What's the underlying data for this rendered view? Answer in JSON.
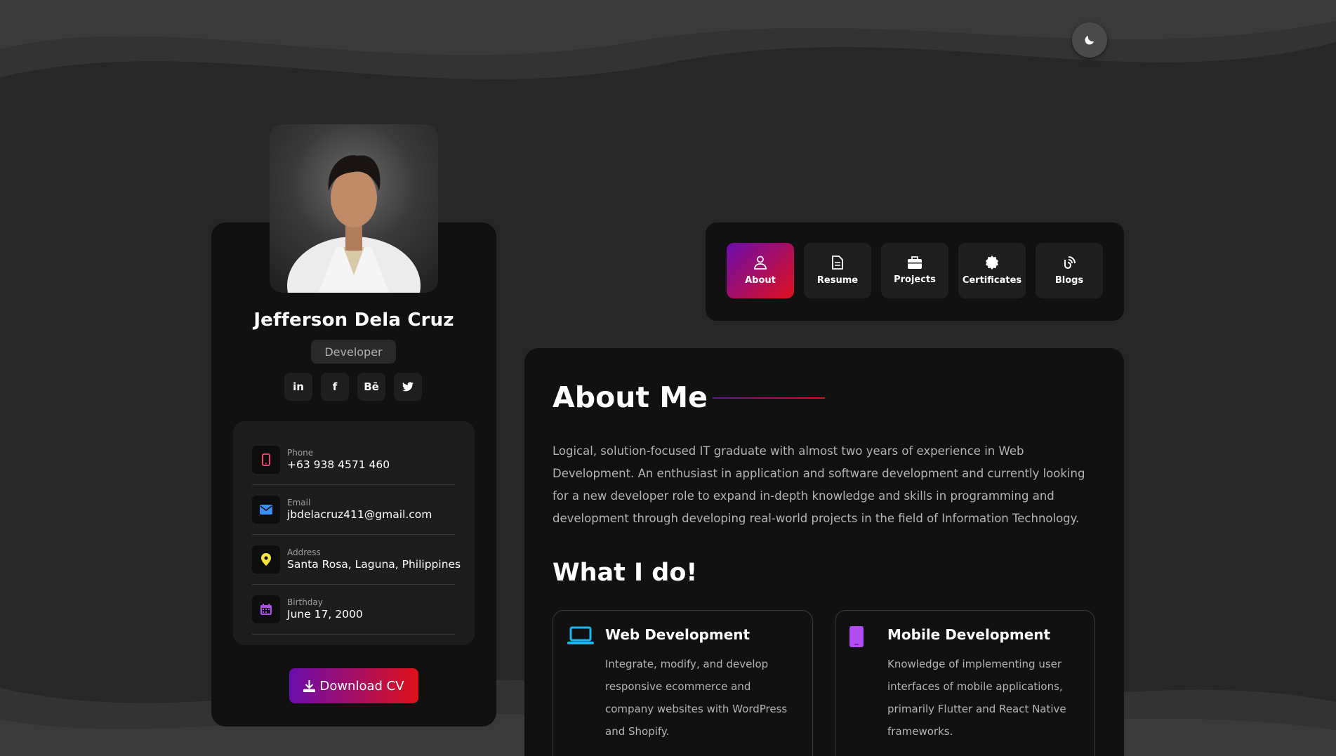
{
  "profile": {
    "name": "Jefferson Dela Cruz",
    "role": "Developer",
    "socials": [
      {
        "label": "in",
        "icon": "linkedin-icon"
      },
      {
        "label": "f",
        "icon": "facebook-icon"
      },
      {
        "label": "Bē",
        "icon": "behance-icon"
      },
      {
        "label": "",
        "icon": "twitter-icon"
      }
    ],
    "contacts": [
      {
        "label": "Phone",
        "value": "+63 938 4571 460",
        "icon": "phone-icon",
        "color": "#ff3a6e"
      },
      {
        "label": "Email",
        "value": "jbdelacruz411@gmail.com",
        "icon": "envelope-icon",
        "color": "#3b8ff6"
      },
      {
        "label": "Address",
        "value": "Santa Rosa, Laguna, Philippines",
        "icon": "map-pin-icon",
        "color": "#f5e23a"
      },
      {
        "label": "Birthday",
        "value": "June 17, 2000",
        "icon": "calendar-icon",
        "color": "#b04cf0"
      }
    ],
    "download_label": "Download CV"
  },
  "nav": {
    "tabs": [
      {
        "label": "About",
        "icon": "user-icon",
        "active": true
      },
      {
        "label": "Resume",
        "icon": "file-icon",
        "active": false
      },
      {
        "label": "Projects",
        "icon": "briefcase-icon",
        "active": false
      },
      {
        "label": "Certificates",
        "icon": "certificate-icon",
        "active": false
      },
      {
        "label": "Blogs",
        "icon": "blog-icon",
        "active": false
      }
    ]
  },
  "about": {
    "title": "About Me",
    "text": "Logical, solution-focused IT graduate with almost two years of experience in Web Development. An enthusiast in application and software development and currently looking for a new developer role to expand in-depth knowledge and skills in programming and development through developing real-world projects in the field of Information Technology."
  },
  "whatido": {
    "title": "What I do!",
    "services": [
      {
        "title": "Web Development",
        "desc": "Integrate, modify, and develop responsive ecommerce and company websites with WordPress and Shopify.",
        "icon": "laptop-icon",
        "color": "#1eb6f0"
      },
      {
        "title": "Mobile Development",
        "desc": "Knowledge of implementing user interfaces of mobile applications, primarily Flutter and React Native frameworks.",
        "icon": "mobile-icon",
        "color": "#b04cf0"
      }
    ]
  },
  "theme": {
    "icon": "moon-icon",
    "accent_start": "#6a0dad",
    "accent_end": "#e0101b"
  }
}
